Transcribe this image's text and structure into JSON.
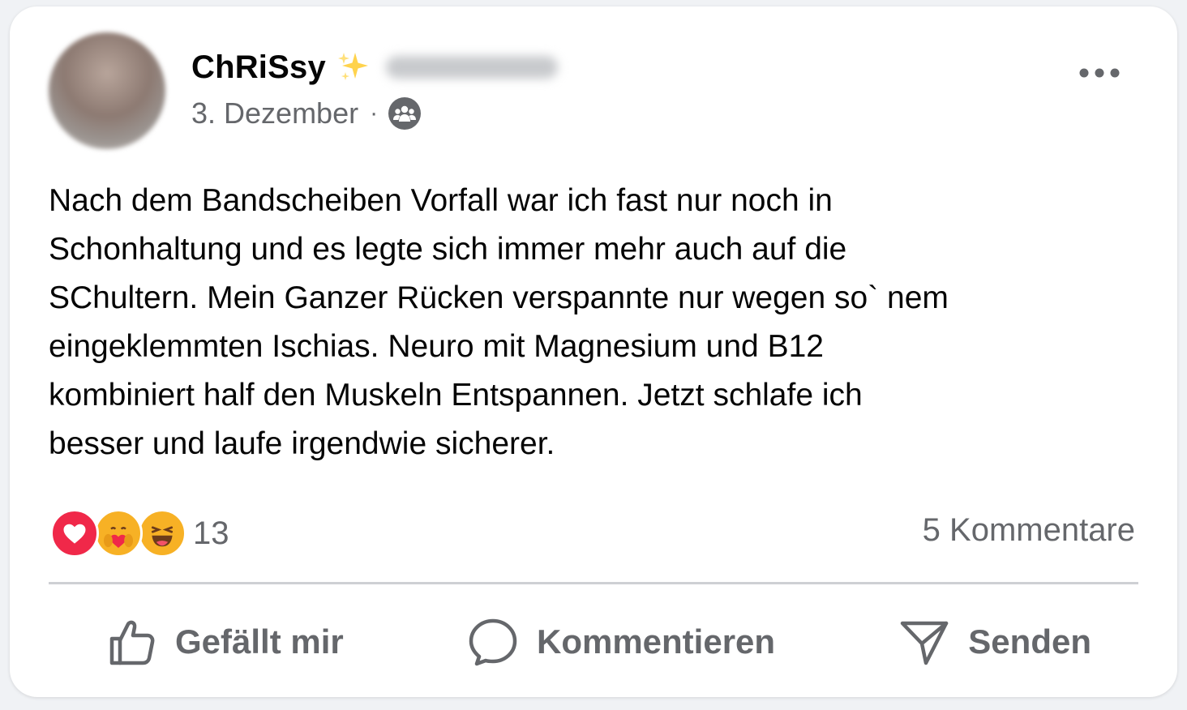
{
  "post": {
    "author": "ChRiSsy",
    "date": "3. Dezember",
    "separator": "·",
    "audience_icon": "group-audience-icon",
    "text": "Nach dem Bandscheiben Vorfall war ich fast nur noch in\nSchonhaltung und es legte sich immer mehr auch auf die\nSChultern. Mein Ganzer Rücken verspannte nur wegen so` nem\neingeklemmten Ischias. Neuro mit Magnesium und B12\nkombiniert half den Muskeln Entspannen. Jetzt schlafe ich\nbesser und laufe irgendwie sicherer."
  },
  "reactions": {
    "icons": [
      "love-reaction-icon",
      "care-reaction-icon",
      "haha-reaction-icon"
    ],
    "count": "13"
  },
  "comments": {
    "label": "5 Kommentare"
  },
  "actions": {
    "like_label": "Gefällt mir",
    "comment_label": "Kommentieren",
    "send_label": "Senden"
  },
  "colors": {
    "text_primary": "#050505",
    "text_secondary": "#65676b",
    "divider": "#ced0d4",
    "love_red": "#f02849",
    "emoji_yellow": "#f7b125"
  }
}
